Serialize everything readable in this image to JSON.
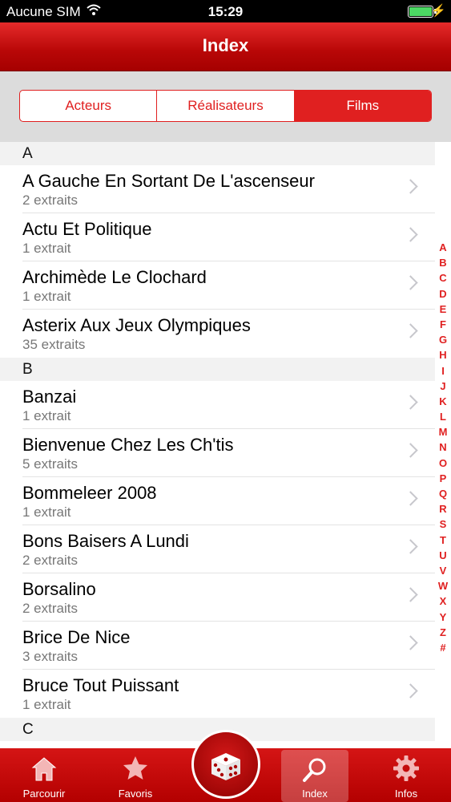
{
  "status_bar": {
    "carrier": "Aucune SIM",
    "time": "15:29",
    "battery_color": "#4cd964"
  },
  "nav": {
    "title": "Index"
  },
  "segments": [
    {
      "label": "Acteurs",
      "active": false
    },
    {
      "label": "Réalisateurs",
      "active": false
    },
    {
      "label": "Films",
      "active": true
    }
  ],
  "sections": [
    {
      "letter": "A",
      "items": [
        {
          "title": "A Gauche En Sortant De L'ascenseur",
          "subtitle": "2 extraits"
        },
        {
          "title": "Actu Et Politique",
          "subtitle": "1 extrait"
        },
        {
          "title": "Archimède Le Clochard",
          "subtitle": "1 extrait"
        },
        {
          "title": "Asterix Aux Jeux Olympiques",
          "subtitle": "35 extraits"
        }
      ]
    },
    {
      "letter": "B",
      "items": [
        {
          "title": "Banzai",
          "subtitle": "1 extrait"
        },
        {
          "title": "Bienvenue Chez Les Ch'tis",
          "subtitle": "5 extraits"
        },
        {
          "title": "Bommeleer 2008",
          "subtitle": "1 extrait"
        },
        {
          "title": "Bons Baisers A Lundi",
          "subtitle": "2 extraits"
        },
        {
          "title": "Borsalino",
          "subtitle": "2 extraits"
        },
        {
          "title": "Brice De Nice",
          "subtitle": "3 extraits"
        },
        {
          "title": "Bruce Tout Puissant",
          "subtitle": "1 extrait"
        }
      ]
    },
    {
      "letter": "C",
      "items": []
    }
  ],
  "index_letters": [
    "A",
    "B",
    "C",
    "D",
    "E",
    "F",
    "G",
    "H",
    "I",
    "J",
    "K",
    "L",
    "M",
    "N",
    "O",
    "P",
    "Q",
    "R",
    "S",
    "T",
    "U",
    "V",
    "W",
    "X",
    "Y",
    "Z",
    "#"
  ],
  "tabs": {
    "parcourir": {
      "label": "Parcourir",
      "icon": "house-icon"
    },
    "favoris": {
      "label": "Favoris",
      "icon": "star-icon"
    },
    "random": {
      "icon": "dice-icon"
    },
    "index": {
      "label": "Index",
      "icon": "magnifier-icon",
      "selected": true
    },
    "infos": {
      "label": "Infos",
      "icon": "gear-icon"
    }
  },
  "colors": {
    "accent": "#e02020",
    "tabbar": "#c40a0a",
    "index_text": "#e02020"
  }
}
